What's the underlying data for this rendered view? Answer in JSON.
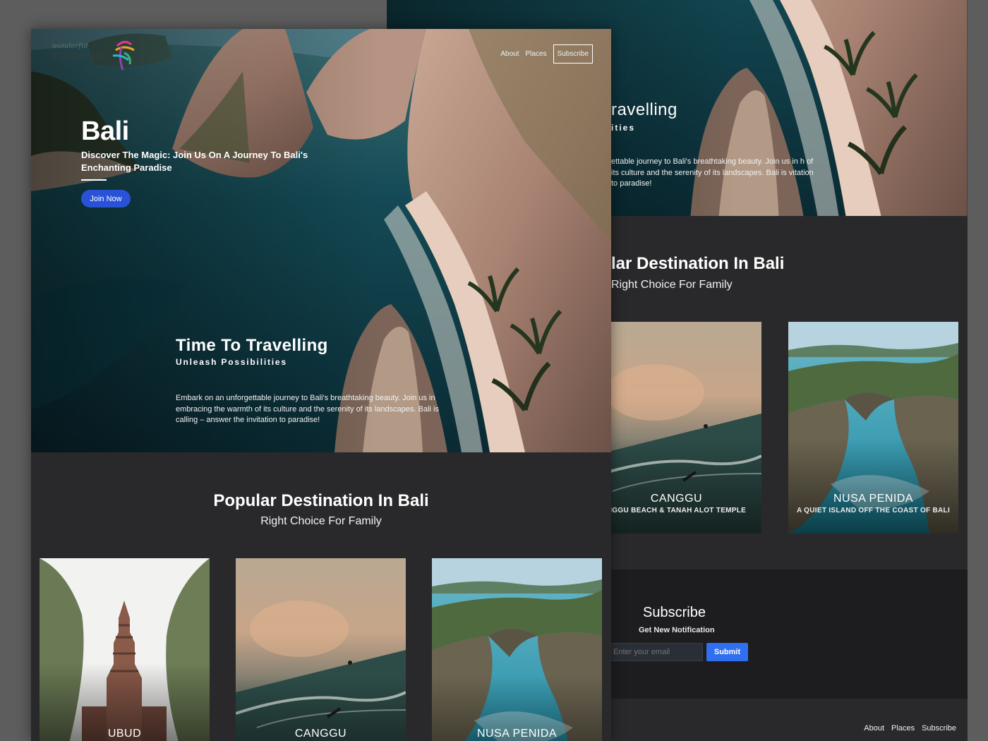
{
  "brand": {
    "wonderful": "wonderful",
    "name": "indonesia"
  },
  "nav": {
    "about": "About",
    "places": "Places",
    "subscribe": "Subscribe"
  },
  "hero": {
    "title": "Bali",
    "tagline": "Discover The Magic: Join Us On A Journey To Bali's Enchanting Paradise",
    "join_label": "Join Now"
  },
  "intro": {
    "title": "Time To Travelling",
    "subtitle": "Unleash Possibilities",
    "body": "Embark on an unforgettable journey to Bali's breathtaking beauty. Join us in embracing the warmth of its culture and the serenity of its landscapes. Bali is calling – answer the invitation to paradise!"
  },
  "back_intro": {
    "title_fragment": "ravelling",
    "subtitle_fragment": "ities",
    "body_fragment": "ettable journey to Bali's breathtaking beauty. Join us in h of its culture and the serenity of its landscapes. Bali is vitation to paradise!"
  },
  "popular": {
    "title": "Popular Destination In Bali",
    "subtitle": "Right Choice For Family",
    "back_title_fragment": "lar Destination In Bali",
    "back_subtitle_fragment": "Right Choice For Family",
    "cards": [
      {
        "name": "UBUD"
      },
      {
        "name": "CANGGU",
        "caption": "NGGU BEACH & TANAH ALOT TEMPLE"
      },
      {
        "name": "NUSA PENIDA",
        "caption": "A QUIET ISLAND OFF THE COAST OF BALI"
      }
    ]
  },
  "subscribe": {
    "title": "Subscribe",
    "subtitle": "Get New Notification",
    "email_placeholder": "Enter your email",
    "submit_label": "Submit"
  },
  "colors": {
    "accent": "#2a52d6",
    "submit": "#2f6ff0",
    "background": "#29292b"
  }
}
